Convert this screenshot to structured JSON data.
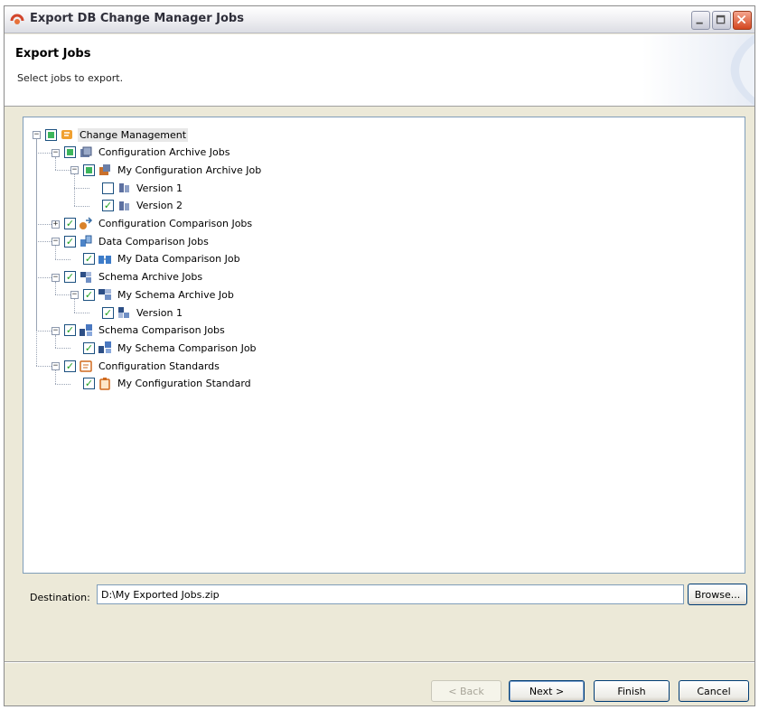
{
  "window": {
    "title": "Export DB Change Manager Jobs"
  },
  "banner": {
    "title": "Export Jobs",
    "description": "Select jobs to export."
  },
  "tree": {
    "nodes": [
      {
        "label": "Change Management",
        "state": "partial",
        "icon": "change-management-icon",
        "expander": "minus"
      },
      {
        "label": "Configuration Archive Jobs",
        "state": "partial",
        "icon": "archive-icon",
        "expander": "minus"
      },
      {
        "label": "My Configuration Archive Job",
        "state": "partial",
        "icon": "archive-job-icon",
        "expander": "minus"
      },
      {
        "label": "Version 1",
        "state": "unchecked",
        "icon": "version-icon",
        "expander": ""
      },
      {
        "label": "Version 2",
        "state": "checked",
        "icon": "version-icon",
        "expander": ""
      },
      {
        "label": "Configuration Comparison Jobs",
        "state": "checked",
        "icon": "comparison-icon",
        "expander": "plus"
      },
      {
        "label": "Data Comparison Jobs",
        "state": "checked",
        "icon": "data-comparison-icon",
        "expander": "minus"
      },
      {
        "label": "My Data Comparison Job",
        "state": "checked",
        "icon": "data-comparison-job-icon",
        "expander": ""
      },
      {
        "label": "Schema Archive Jobs",
        "state": "checked",
        "icon": "schema-archive-icon",
        "expander": "minus"
      },
      {
        "label": "My Schema Archive Job",
        "state": "checked",
        "icon": "schema-archive-job-icon",
        "expander": "minus"
      },
      {
        "label": "Version 1",
        "state": "checked",
        "icon": "schema-version-icon",
        "expander": ""
      },
      {
        "label": "Schema Comparison Jobs",
        "state": "checked",
        "icon": "schema-comparison-icon",
        "expander": "minus"
      },
      {
        "label": "My Schema Comparison Job",
        "state": "checked",
        "icon": "schema-comparison-job-icon",
        "expander": ""
      },
      {
        "label": "Configuration Standards",
        "state": "checked",
        "icon": "config-standards-icon",
        "expander": "minus"
      },
      {
        "label": "My Configuration Standard",
        "state": "checked",
        "icon": "config-standard-icon",
        "expander": ""
      }
    ]
  },
  "destination": {
    "label": "Destination:",
    "value": "D:\\My Exported Jobs.zip"
  },
  "buttons": {
    "browse": "Browse...",
    "back": "< Back",
    "next": "Next >",
    "finish": "Finish",
    "cancel": "Cancel"
  },
  "colors": {
    "check": "#21a121",
    "partial": "#3cb55c",
    "frame": "#ece9d8"
  }
}
